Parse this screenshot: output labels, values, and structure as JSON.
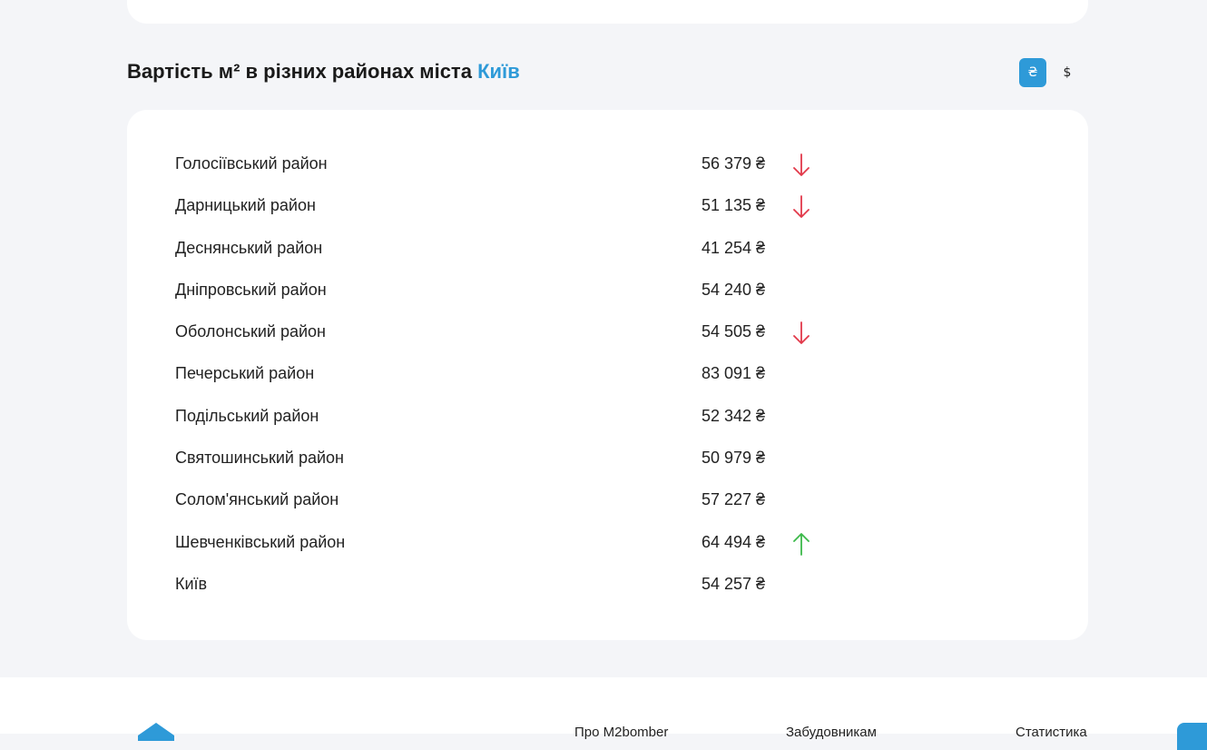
{
  "section": {
    "title_prefix": "Вартість м² в різних районах міста",
    "city": "Київ",
    "currency": {
      "uah_label": "₴",
      "usd_label": "$",
      "selected": "uah"
    }
  },
  "districts": [
    {
      "name": "Голосіївський район",
      "price": "56 379 ₴",
      "trend": "down"
    },
    {
      "name": "Дарницький район",
      "price": "51 135 ₴",
      "trend": "down"
    },
    {
      "name": "Деснянський район",
      "price": "41 254 ₴",
      "trend": "none"
    },
    {
      "name": "Дніпровський район",
      "price": "54 240 ₴",
      "trend": "none"
    },
    {
      "name": "Оболонський район",
      "price": "54 505 ₴",
      "trend": "down"
    },
    {
      "name": "Печерський район",
      "price": "83 091 ₴",
      "trend": "none"
    },
    {
      "name": "Подільський район",
      "price": "52 342 ₴",
      "trend": "none"
    },
    {
      "name": "Святошинський район",
      "price": "50 979 ₴",
      "trend": "none"
    },
    {
      "name": "Солом'янський район",
      "price": "57 227 ₴",
      "trend": "none"
    },
    {
      "name": "Шевченківський район",
      "price": "64 494 ₴",
      "trend": "up"
    },
    {
      "name": "Київ",
      "price": "54 257 ₴",
      "trend": "none"
    }
  ],
  "footer": {
    "links": [
      "Про M2bomber",
      "Забудовникам",
      "Статистика"
    ]
  },
  "colors": {
    "accent": "#2e9ad8",
    "trend_down": "#e2394a",
    "trend_up": "#3cb94a"
  },
  "icons": {
    "trend_down": "arrow-down-icon",
    "trend_up": "arrow-up-icon"
  }
}
